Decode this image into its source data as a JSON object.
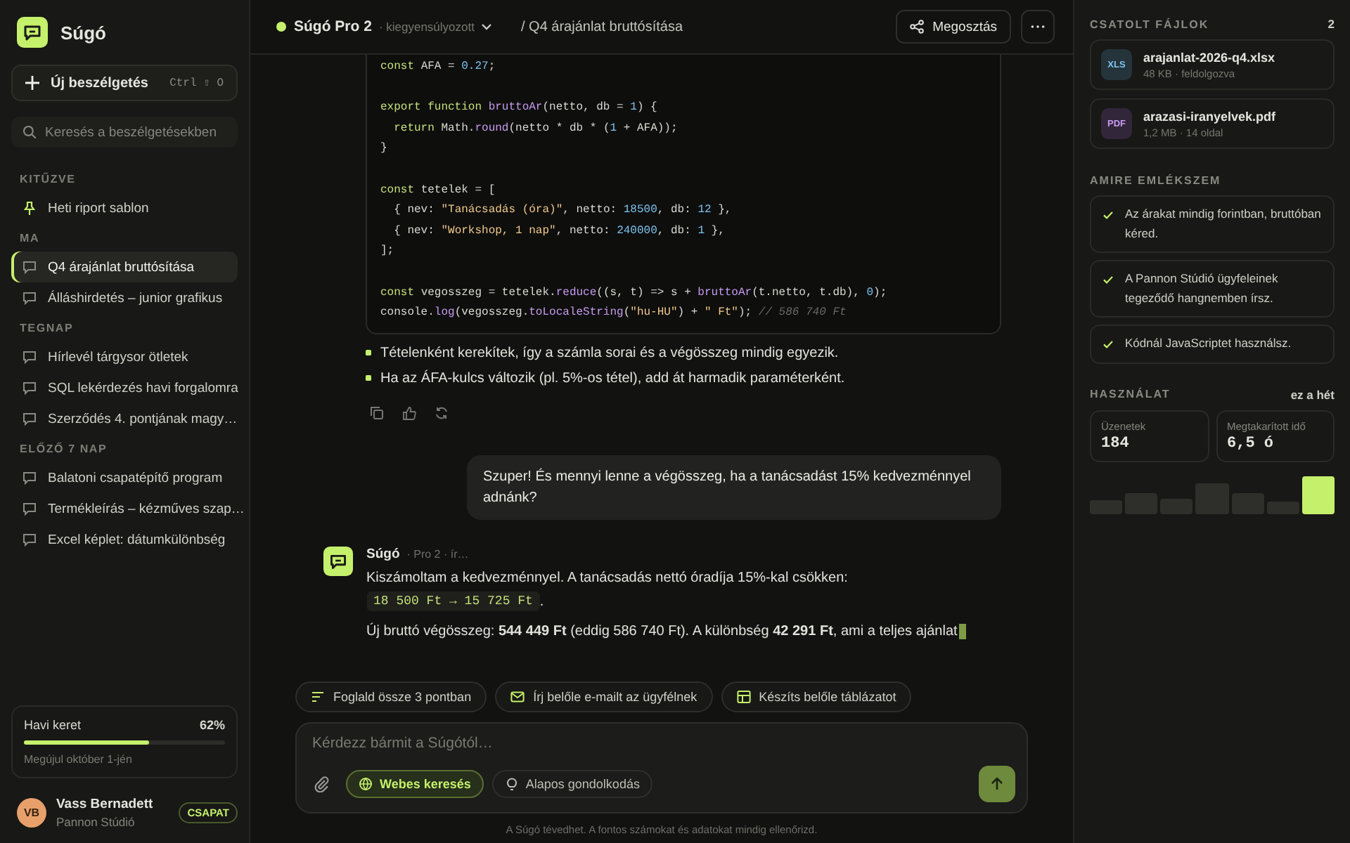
{
  "sidebar": {
    "brand": "Súgó",
    "new_chat": {
      "label": "Új beszélgetés",
      "shortcut": "Ctrl ⇧ O"
    },
    "search": {
      "placeholder": "Keresés a beszélgetésekben"
    },
    "sections": [
      {
        "title": "KITŰZVE",
        "items": [
          {
            "label": "Heti riport sablon",
            "kind": "pinned",
            "selected": false
          }
        ]
      },
      {
        "title": "MA",
        "items": [
          {
            "label": "Q4 árajánlat bruttósítása",
            "kind": "chat",
            "selected": true
          },
          {
            "label": "Álláshirdetés – junior grafikus",
            "kind": "chat",
            "selected": false
          }
        ]
      },
      {
        "title": "TEGNAP",
        "items": [
          {
            "label": "Hírlevél tárgysor ötletek",
            "kind": "chat",
            "selected": false
          },
          {
            "label": "SQL lekérdezés havi forgalomra",
            "kind": "chat",
            "selected": false
          },
          {
            "label": "Szerződés 4. pontjának magy…",
            "kind": "chat",
            "selected": false
          }
        ]
      },
      {
        "title": "ELŐZŐ 7 NAP",
        "items": [
          {
            "label": "Balatoni csapatépítő program",
            "kind": "chat",
            "selected": false
          },
          {
            "label": "Termékleírás – kézműves szap…",
            "kind": "chat",
            "selected": false
          },
          {
            "label": "Excel képlet: dátumkülönbség",
            "kind": "chat",
            "selected": false
          }
        ]
      }
    ],
    "quota": {
      "label": "Havi keret",
      "percent": "62%",
      "level": 0.62,
      "note": "Megújul október 1-jén"
    },
    "user": {
      "initials": "VB",
      "name": "Vass Bernadett",
      "org": "Pannon Stúdió",
      "badge": "CSAPAT"
    }
  },
  "header": {
    "model": "Súgó Pro 2",
    "mode": "· kiegyensúlyozott",
    "title": "/ Q4 árajánlat bruttósítása",
    "share": "Megosztás"
  },
  "code": [
    {
      "kind": "code",
      "tokens": [
        {
          "kind": "keyword",
          "text": "const"
        },
        {
          "kind": "plain",
          "text": " AFA = "
        },
        {
          "kind": "number",
          "text": "0.27"
        },
        {
          "kind": "plain",
          "text": ";"
        }
      ]
    },
    {
      "kind": "blank"
    },
    {
      "kind": "code",
      "tokens": [
        {
          "kind": "keyword",
          "text": "export function "
        },
        {
          "kind": "function",
          "text": "bruttoAr"
        },
        {
          "kind": "plain",
          "text": "(netto, db = "
        },
        {
          "kind": "number",
          "text": "1"
        },
        {
          "kind": "plain",
          "text": ") {"
        }
      ]
    },
    {
      "kind": "code",
      "tokens": [
        {
          "kind": "keyword",
          "text": "  return"
        },
        {
          "kind": "plain",
          "text": " Math."
        },
        {
          "kind": "function",
          "text": "round"
        },
        {
          "kind": "plain",
          "text": "(netto * db * ("
        },
        {
          "kind": "number",
          "text": "1"
        },
        {
          "kind": "plain",
          "text": " + AFA));"
        }
      ]
    },
    {
      "kind": "code",
      "tokens": [
        {
          "kind": "plain",
          "text": "}"
        }
      ]
    },
    {
      "kind": "blank"
    },
    {
      "kind": "code",
      "tokens": [
        {
          "kind": "keyword",
          "text": "const"
        },
        {
          "kind": "plain",
          "text": " tetelek = ["
        }
      ]
    },
    {
      "kind": "code",
      "tokens": [
        {
          "kind": "plain",
          "text": "  { nev: "
        },
        {
          "kind": "string",
          "text": "\"Tanácsadás (óra)\""
        },
        {
          "kind": "plain",
          "text": ", netto: "
        },
        {
          "kind": "number",
          "text": "18500"
        },
        {
          "kind": "plain",
          "text": ", db: "
        },
        {
          "kind": "number",
          "text": "12"
        },
        {
          "kind": "plain",
          "text": " },"
        }
      ]
    },
    {
      "kind": "code",
      "tokens": [
        {
          "kind": "plain",
          "text": "  { nev: "
        },
        {
          "kind": "string",
          "text": "\"Workshop, 1 nap\""
        },
        {
          "kind": "plain",
          "text": ", netto: "
        },
        {
          "kind": "number",
          "text": "240000"
        },
        {
          "kind": "plain",
          "text": ", db: "
        },
        {
          "kind": "number",
          "text": "1"
        },
        {
          "kind": "plain",
          "text": " },"
        }
      ]
    },
    {
      "kind": "code",
      "tokens": [
        {
          "kind": "plain",
          "text": "];"
        }
      ]
    },
    {
      "kind": "blank"
    },
    {
      "kind": "code",
      "tokens": [
        {
          "kind": "keyword",
          "text": "const"
        },
        {
          "kind": "plain",
          "text": " vegosszeg = tetelek."
        },
        {
          "kind": "function",
          "text": "reduce"
        },
        {
          "kind": "plain",
          "text": "((s, t) => s + "
        },
        {
          "kind": "function",
          "text": "bruttoAr"
        },
        {
          "kind": "plain",
          "text": "(t.netto, t.db), "
        },
        {
          "kind": "number",
          "text": "0"
        },
        {
          "kind": "plain",
          "text": ");"
        }
      ]
    },
    {
      "kind": "code",
      "tokens": [
        {
          "kind": "plain",
          "text": "console."
        },
        {
          "kind": "function",
          "text": "log"
        },
        {
          "kind": "plain",
          "text": "(vegosszeg."
        },
        {
          "kind": "function",
          "text": "toLocaleString"
        },
        {
          "kind": "plain",
          "text": "("
        },
        {
          "kind": "string",
          "text": "\"hu-HU\""
        },
        {
          "kind": "plain",
          "text": ") + "
        },
        {
          "kind": "string",
          "text": "\" Ft\""
        },
        {
          "kind": "plain",
          "text": "); "
        },
        {
          "kind": "comment",
          "text": "// 586 740 Ft"
        }
      ]
    }
  ],
  "bullets": [
    "Tételenként kerekítek, így a számla sorai és a végösszeg mindig egyezik.",
    "Ha az ÁFA-kulcs változik (pl. 5%-os tétel), add át harmadik paraméterként."
  ],
  "user_message": "Szuper! És mennyi lenne a végösszeg, ha a tanácsadást 15% kedvezménnyel adnánk?",
  "reply": {
    "name": "Súgó",
    "meta": "· Pro 2 · ír…",
    "intro": "Kiszámoltam a kedvezménnyel. A tanácsadás nettó óradíja 15%-kal csökken:",
    "code": "18 500 Ft → 15 725 Ft",
    "code_tail": ".",
    "result": "Új bruttó végösszeg: **544 449 Ft** (eddig 586 740 Ft). A különbség **42 291 Ft**, ami a teljes ajánlat"
  },
  "suggestions": [
    {
      "label": "Foglald össze 3 pontban",
      "kind": "summary"
    },
    {
      "label": "Írj belőle e-mailt az ügyfélnek",
      "kind": "mail"
    },
    {
      "label": "Készíts belőle táblázatot",
      "kind": "table"
    }
  ],
  "composer": {
    "placeholder": "Kérdezz bármit a Súgótól…",
    "toggles": [
      {
        "label": "Webes keresés",
        "kind": "web",
        "selected": true
      },
      {
        "label": "Alapos gondolkodás",
        "kind": "think",
        "selected": false
      }
    ]
  },
  "disclaimer": "A Súgó tévedhet. A fontos számokat és adatokat mindig ellenőrizd.",
  "panel": {
    "files_title": "CSATOLT FÁJLOK",
    "files_count": "2",
    "files": [
      {
        "type": "XLS",
        "name": "arajanlat-2026-q4.xlsx",
        "meta": "48 KB · feldolgozva"
      },
      {
        "type": "PDF",
        "name": "arazasi-iranyelvek.pdf",
        "meta": "1,2 MB · 14 oldal"
      }
    ],
    "memory_title": "AMIRE EMLÉKSZEM",
    "memories": [
      "Az árakat mindig forintban, bruttóban kéred.",
      "A Pannon Stúdió ügyfeleinek tegeződő hangnemben írsz.",
      "Kódnál JavaScriptet használsz."
    ],
    "usage_title": "HASZNÁLAT",
    "usage_period": "ez a hét",
    "stats": [
      {
        "label": "Üzenetek",
        "value": "184"
      },
      {
        "label": "Megtakarított idő",
        "value": "6,5 ó"
      }
    ]
  }
}
